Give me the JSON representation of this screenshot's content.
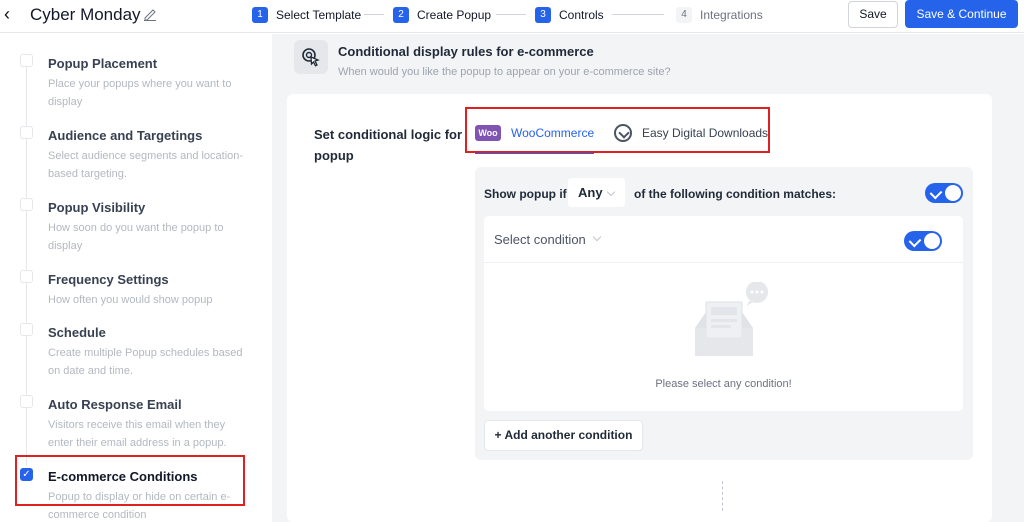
{
  "header": {
    "back_icon": "chevron-left-icon",
    "campaign_title": "Cyber Monday",
    "edit_icon": "pencil-icon",
    "steps": [
      {
        "num": "1",
        "label": "Select Template",
        "state": "done"
      },
      {
        "num": "2",
        "label": "Create Popup",
        "state": "done"
      },
      {
        "num": "3",
        "label": "Controls",
        "state": "current"
      },
      {
        "num": "4",
        "label": "Integrations",
        "state": "upcoming"
      }
    ],
    "save_label": "Save",
    "continue_label": "Save & Continue",
    "accent_color": "#2563eb"
  },
  "sidebar": {
    "items": [
      {
        "title": "Popup Placement",
        "desc": "Place your popups where you want to display",
        "checked": false
      },
      {
        "title": "Audience and Targetings",
        "desc": "Select audience segments and location-based targeting.",
        "checked": false
      },
      {
        "title": "Popup Visibility",
        "desc": "How soon do you want the popup to display",
        "checked": false
      },
      {
        "title": "Frequency Settings",
        "desc": "How often you would show popup",
        "checked": false
      },
      {
        "title": "Schedule",
        "desc": "Create multiple Popup schedules based on date and time.",
        "checked": false
      },
      {
        "title": "Auto Response Email",
        "desc": "Visitors receive this email when they enter their email address in a popup.",
        "checked": false
      },
      {
        "title": "E-commerce Conditions",
        "desc": "Popup to display or hide on certain e-commerce condition",
        "checked": true
      }
    ]
  },
  "main": {
    "section_icon": "cursor-click-icon",
    "section_title": "Conditional display rules for e-commerce",
    "section_subtitle": "When would you like the popup to appear on your e-commerce site?",
    "logic_label": "Set conditional logic for popup",
    "tabs": [
      {
        "logo_text": "Woo",
        "label": "WooCommerce",
        "active": true
      },
      {
        "label": "Easy Digital Downloads",
        "active": false
      }
    ],
    "rule": {
      "prefix": "Show popup if",
      "match_value": "Any",
      "suffix": "of the following condition matches:",
      "enabled": true
    },
    "condition": {
      "select_placeholder": "Select condition",
      "enabled": true,
      "empty_text": "Please select any condition!"
    },
    "add_condition_label": "+ Add another condition"
  },
  "highlight_color": "#e02020"
}
